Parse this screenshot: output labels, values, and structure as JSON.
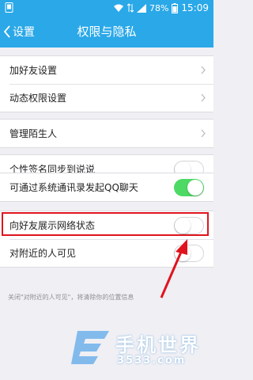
{
  "status_bar": {
    "battery": "78%",
    "time": "15:09"
  },
  "nav": {
    "back_label": "设置",
    "title": "权限与隐私"
  },
  "group1": {
    "items": [
      {
        "label": "加好友设置"
      },
      {
        "label": "动态权限设置"
      }
    ]
  },
  "group2": {
    "items": [
      {
        "label": "管理陌生人"
      }
    ]
  },
  "group3": {
    "label": "个性签名同步到说说",
    "enabled": false
  },
  "group4": {
    "label": "可通过系统通讯录发起QQ聊天",
    "enabled": true
  },
  "group5": {
    "items": [
      {
        "label": "向好友展示网络状态",
        "enabled": false
      },
      {
        "label": "对附近的人可见",
        "enabled": false
      }
    ],
    "note": "关闭\"对附近的人可见\"，将清除你的位置信息"
  },
  "watermark": {
    "title": "手机世界",
    "subtitle": "3533.com"
  },
  "colors": {
    "nav": "#2aa8e8",
    "toggle_on": "#4cd964",
    "highlight": "#e0141e"
  }
}
